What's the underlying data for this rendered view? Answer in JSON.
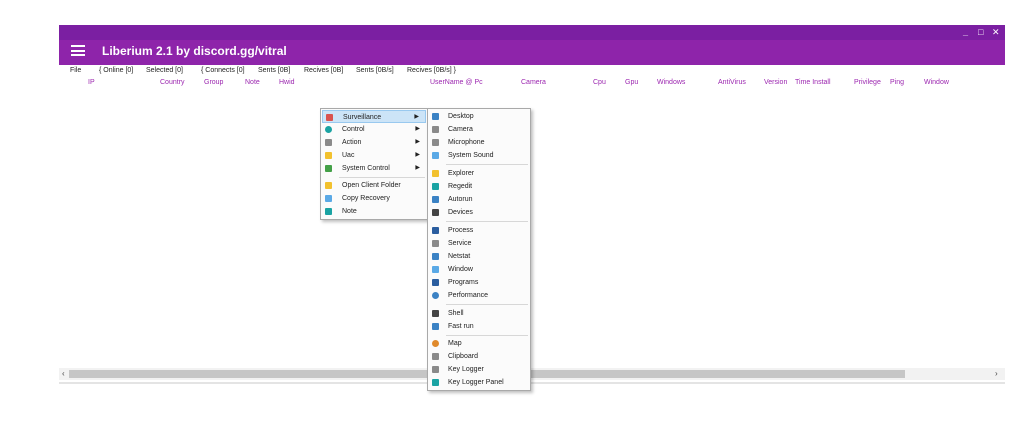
{
  "window": {
    "title": "Liberium 2.1 by discord.gg/vitral",
    "controls": {
      "minimize": "_",
      "maximize": "□",
      "close": "✕"
    },
    "accent_color": "#8e24aa"
  },
  "menubar": {
    "file": "File",
    "online": "{ Online [0]",
    "selected": "Selected [0]",
    "connects": "{ Connects [0]",
    "sents": "Sents [0B]",
    "recives": "Recives [0B]",
    "sents_rate": "Sents [0B/s]",
    "recives_rate": "Recives [0B/s] }"
  },
  "columns": [
    "IP",
    "Country",
    "Group",
    "Note",
    "Hwid",
    "UserName @ Pc",
    "Camera",
    "Cpu",
    "Gpu",
    "Windows",
    "AntiVirus",
    "Version",
    "Time Install",
    "Privilege",
    "Ping",
    "Window"
  ],
  "context_menu": {
    "main": [
      {
        "label": "Surveillance",
        "icon": "surveillance-icon",
        "submenu": true,
        "selected": true
      },
      {
        "label": "Control",
        "icon": "control-icon",
        "submenu": true
      },
      {
        "label": "Action",
        "icon": "action-icon",
        "submenu": true
      },
      {
        "label": "Uac",
        "icon": "uac-shield-icon",
        "submenu": true
      },
      {
        "label": "System Control",
        "icon": "system-control-icon",
        "submenu": true
      },
      {
        "label": "Open Client Folder",
        "icon": "folder-icon"
      },
      {
        "label": "Copy Recovery",
        "icon": "document-icon"
      },
      {
        "label": "Note",
        "icon": "note-icon"
      }
    ],
    "submenu": [
      {
        "label": "Desktop",
        "icon": "desktop-icon"
      },
      {
        "label": "Camera",
        "icon": "camera-icon"
      },
      {
        "label": "Microphone",
        "icon": "microphone-icon"
      },
      {
        "label": "System Sound",
        "icon": "speaker-icon"
      },
      {
        "label": "Explorer",
        "icon": "explorer-icon"
      },
      {
        "label": "Regedit",
        "icon": "regedit-icon"
      },
      {
        "label": "Autorun",
        "icon": "autorun-icon"
      },
      {
        "label": "Devices",
        "icon": "devices-icon"
      },
      {
        "label": "Process",
        "icon": "process-icon"
      },
      {
        "label": "Service",
        "icon": "service-icon"
      },
      {
        "label": "Netstat",
        "icon": "netstat-icon"
      },
      {
        "label": "Window",
        "icon": "window-icon"
      },
      {
        "label": "Programs",
        "icon": "programs-icon"
      },
      {
        "label": "Performance",
        "icon": "performance-icon"
      },
      {
        "label": "Shell",
        "icon": "shell-icon"
      },
      {
        "label": "Fast run",
        "icon": "fast-run-icon"
      },
      {
        "label": "Map",
        "icon": "map-icon"
      },
      {
        "label": "Clipboard",
        "icon": "clipboard-icon"
      },
      {
        "label": "Key Logger",
        "icon": "keyboard-icon"
      },
      {
        "label": "Key Logger Panel",
        "icon": "keylogger-panel-icon"
      }
    ]
  },
  "scrollbar": {
    "left": "‹",
    "right": "›"
  }
}
